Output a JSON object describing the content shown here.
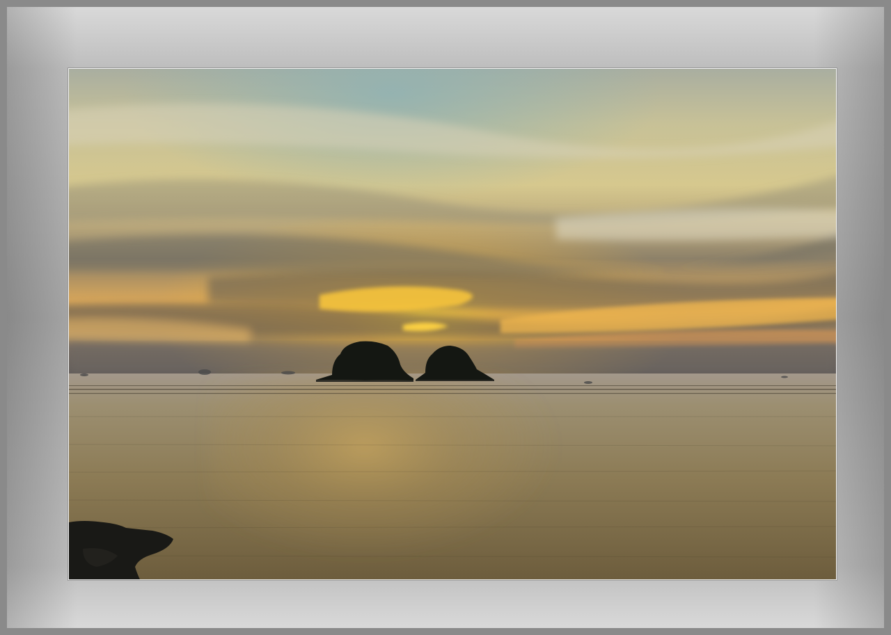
{
  "scene": {
    "subject": "sunset-over-sea-with-two-islets",
    "colors": {
      "frame_light": "#d9d9d9",
      "frame_dark": "#8a8a8a",
      "sky_top": "#8fa3a3",
      "sun_glow": "#f7c23a",
      "sea": "#8a7a55",
      "silhouette": "#1a1c17"
    }
  }
}
